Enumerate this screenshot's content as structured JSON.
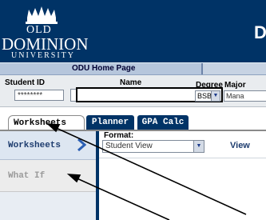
{
  "header": {
    "university_line1": "OLD",
    "university_line2": "DOMINION",
    "university_line3": "UNIVERSITY",
    "title_cut_letter": "D",
    "brand_color": "#003366",
    "logo_icon": "crown-icon"
  },
  "homebar": {
    "home_link": "ODU Home Page"
  },
  "student_info": {
    "student_id_label": "Student ID",
    "student_id_value": "********",
    "name_label": "Name",
    "degree_label": "Degree",
    "degree_value": "BSBA",
    "major_label": "Major",
    "major_value": "Mana"
  },
  "tabs": [
    {
      "label": "Worksheets",
      "active": true
    },
    {
      "label": "Planner",
      "active": false
    },
    {
      "label": "GPA Calc",
      "active": false
    }
  ],
  "sidebar": {
    "items": [
      {
        "label": "Worksheets",
        "active": true,
        "icon": "chevron-right-icon"
      },
      {
        "label": "What If",
        "active": false
      }
    ]
  },
  "main": {
    "format_label": "Format:",
    "format_value": "Student View",
    "view_button": "View"
  }
}
